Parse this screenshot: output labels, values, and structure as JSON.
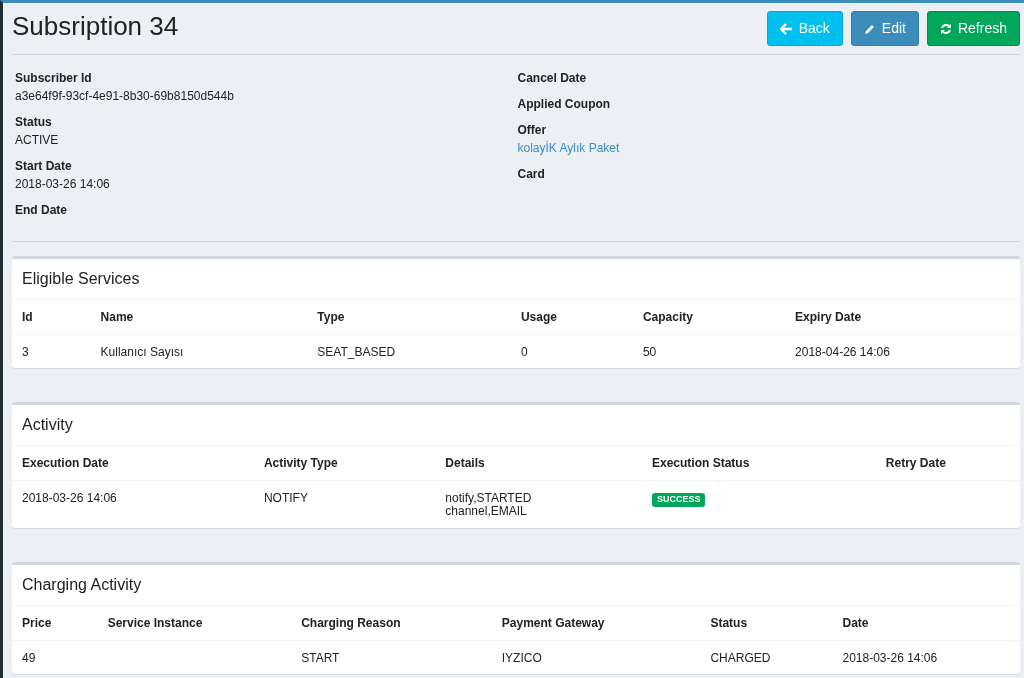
{
  "title": "Subsription 34",
  "buttons": [
    {
      "label": "Back",
      "kind": "back"
    },
    {
      "label": "Edit",
      "kind": "edit"
    },
    {
      "label": "Refresh",
      "kind": "refresh"
    }
  ],
  "details_left": [
    {
      "label": "Subscriber Id",
      "value": "a3e64f9f-93cf-4e91-8b30-69b8150d544b"
    },
    {
      "label": "Status",
      "value": "ACTIVE"
    },
    {
      "label": "Start Date",
      "value": "2018-03-26 14:06"
    },
    {
      "label": "End Date"
    }
  ],
  "details_right": [
    {
      "label": "Cancel Date"
    },
    {
      "label": "Applied Coupon"
    },
    {
      "label": "Offer",
      "value": "kolayİK Aylık Paket",
      "kind": "link"
    },
    {
      "label": "Card"
    }
  ],
  "panels": [
    {
      "title": "Eligible Services",
      "columns": [
        "Id",
        "Name",
        "Type",
        "Usage",
        "Capacity",
        "Expiry Date"
      ],
      "rows": [
        [
          "3",
          "Kullanıcı Sayısı",
          "SEAT_BASED",
          "0",
          "50",
          "2018-04-26 14:06"
        ]
      ]
    },
    {
      "title": "Activity",
      "columns": [
        "Execution Date",
        "Activity Type",
        "Details",
        "Execution Status",
        "Retry Date"
      ],
      "rows": [
        [
          "2018-03-26 14:06",
          "NOTIFY",
          "notify,STARTED\nchannel,EMAIL",
          {
            "text": "SUCCESS",
            "kind": "badge"
          },
          ""
        ]
      ]
    },
    {
      "title": "Charging Activity",
      "columns": [
        "Price",
        "Service Instance",
        "Charging Reason",
        "Payment Gateway",
        "Status",
        "Date"
      ],
      "rows": [
        [
          "49",
          "",
          "START",
          "IYZICO",
          "CHARGED",
          "2018-03-26 14:06"
        ]
      ]
    }
  ]
}
